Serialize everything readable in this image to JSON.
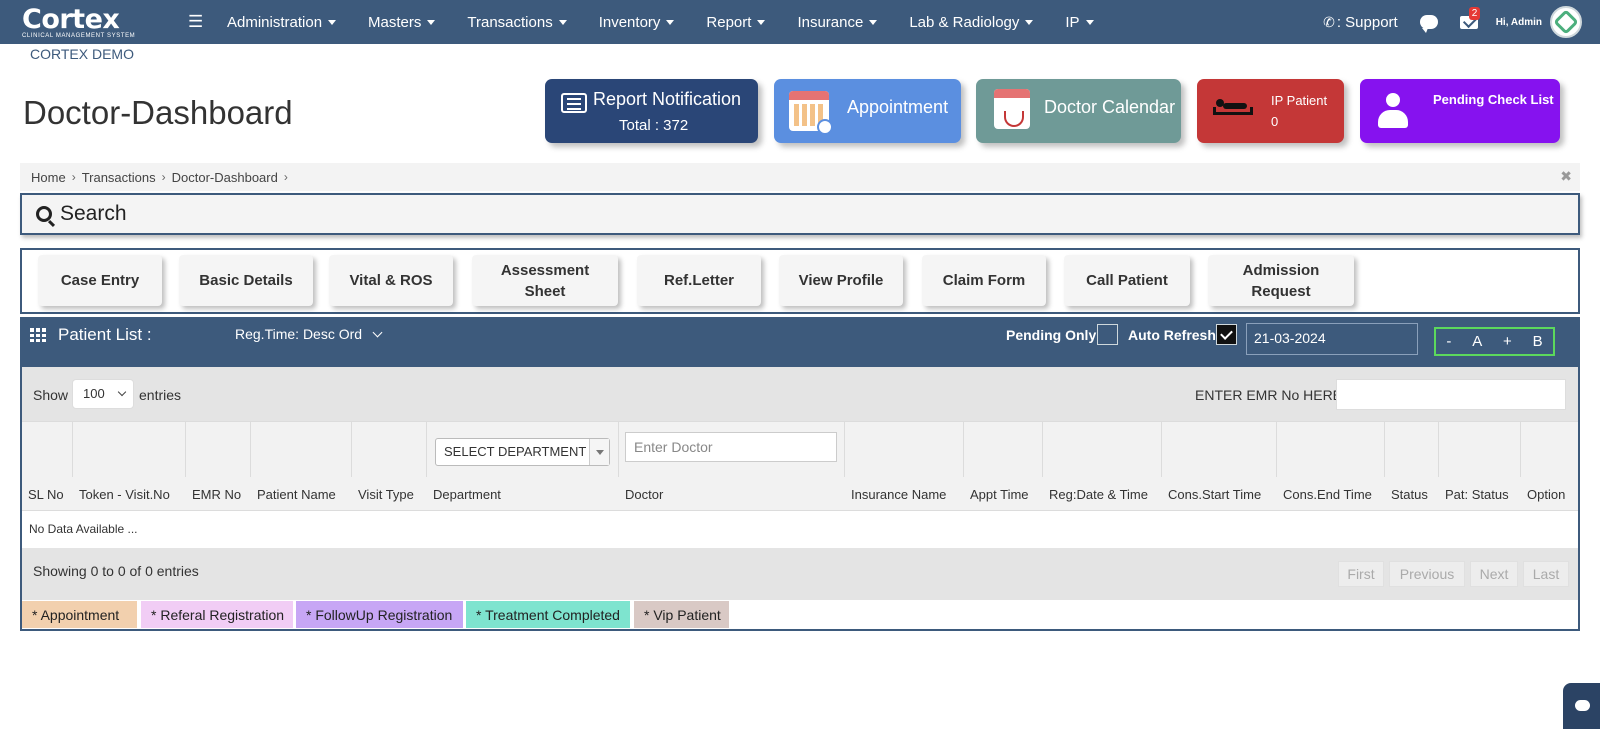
{
  "brand": {
    "name": "Cortex",
    "tagline": "CLINICAL MANAGEMENT SYSTEM"
  },
  "nav": {
    "items": [
      {
        "label": "Administration"
      },
      {
        "label": "Masters"
      },
      {
        "label": "Transactions"
      },
      {
        "label": "Inventory"
      },
      {
        "label": "Report"
      },
      {
        "label": "Insurance"
      },
      {
        "label": "Lab & Radiology"
      },
      {
        "label": "IP"
      }
    ],
    "support": ": Support",
    "mail_badge": "2",
    "greeting": "Hi, Admin"
  },
  "org_name": "CORTEX DEMO",
  "page_title": "Doctor-Dashboard",
  "cards": {
    "report": {
      "title": "Report Notification",
      "total": "Total : 372"
    },
    "appointment": {
      "title": "Appointment"
    },
    "doctor_calendar": {
      "title": "Doctor Calendar"
    },
    "ip_patient": {
      "title": "IP Patient",
      "count": "0"
    },
    "pending": {
      "title": "Pending Check List"
    }
  },
  "breadcrumb": [
    "Home",
    "Transactions",
    "Doctor-Dashboard"
  ],
  "search": {
    "label": "Search"
  },
  "actions": [
    {
      "label": "Case Entry"
    },
    {
      "label": "Basic Details"
    },
    {
      "label": "Vital & ROS"
    },
    {
      "label": "Assessment Sheet"
    },
    {
      "label": "Ref.Letter"
    },
    {
      "label": "View Profile"
    },
    {
      "label": "Claim Form"
    },
    {
      "label": "Call Patient"
    },
    {
      "label": "Admission Request"
    }
  ],
  "patient_list": {
    "title": "Patient List :",
    "sort": "Reg.Time: Desc Ord",
    "pending_only": "Pending Only",
    "auto_refresh": "Auto Refresh",
    "date": "21-03-2024",
    "zoom": [
      "-",
      "A",
      "+",
      "B"
    ]
  },
  "table": {
    "show": "Show",
    "entries_value": "100",
    "entries": "entries",
    "emr_label": "ENTER EMR No HERE:",
    "department_select": "SELECT DEPARTMENT",
    "doctor_placeholder": "Enter Doctor",
    "columns": [
      "SL No",
      "Token - Visit.No",
      "EMR No",
      "Patient Name",
      "Visit Type",
      "Department",
      "Doctor",
      "Insurance Name",
      "Appt Time",
      "Reg:Date & Time",
      "Cons.Start Time",
      "Cons.End Time",
      "Status",
      "Pat: Status",
      "Option"
    ],
    "no_data": "No Data Available ...",
    "info": "Showing 0 to 0 of 0 entries",
    "pagination": [
      "First",
      "Previous",
      "Next",
      "Last"
    ]
  },
  "legend": [
    {
      "label": "* Appointment",
      "color": "#f2d0ae"
    },
    {
      "label": "* Referal Registration",
      "color": "#f1cdf5"
    },
    {
      "label": "* FollowUp Registration",
      "color": "#c7a6f5"
    },
    {
      "label": "* Treatment Completed",
      "color": "#7ee4cf"
    },
    {
      "label": "* Vip Patient",
      "color": "#d9c9c5"
    }
  ],
  "colors": {
    "nav": "#3d5a7c",
    "accent_green": "#5cd85c"
  }
}
